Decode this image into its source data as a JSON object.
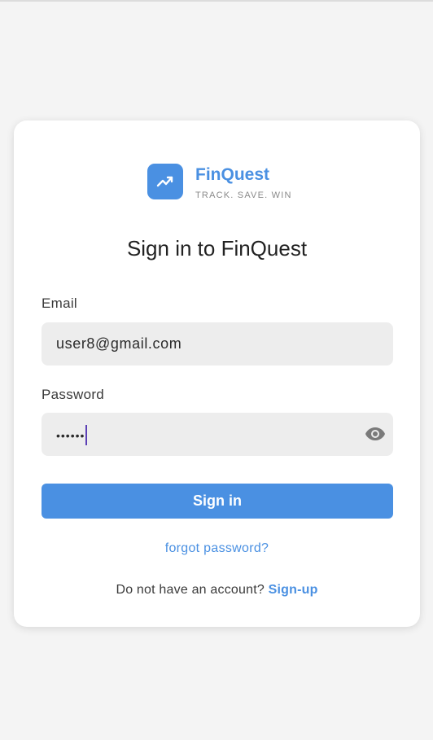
{
  "brand": {
    "name": "FinQuest",
    "tagline": "TRACK. SAVE. WIN",
    "logo_icon": "trending-up-icon",
    "accent_color": "#4a90e2"
  },
  "form": {
    "title": "Sign in to FinQuest",
    "email_label": "Email",
    "email_value": "user8@gmail.com",
    "password_label": "Password",
    "password_value": "••••••",
    "password_toggle_icon": "eye-icon",
    "submit_label": "Sign in",
    "forgot_label": "forgot password?",
    "no_account_text": "Do not have an account?",
    "signup_label": "Sign-up"
  }
}
